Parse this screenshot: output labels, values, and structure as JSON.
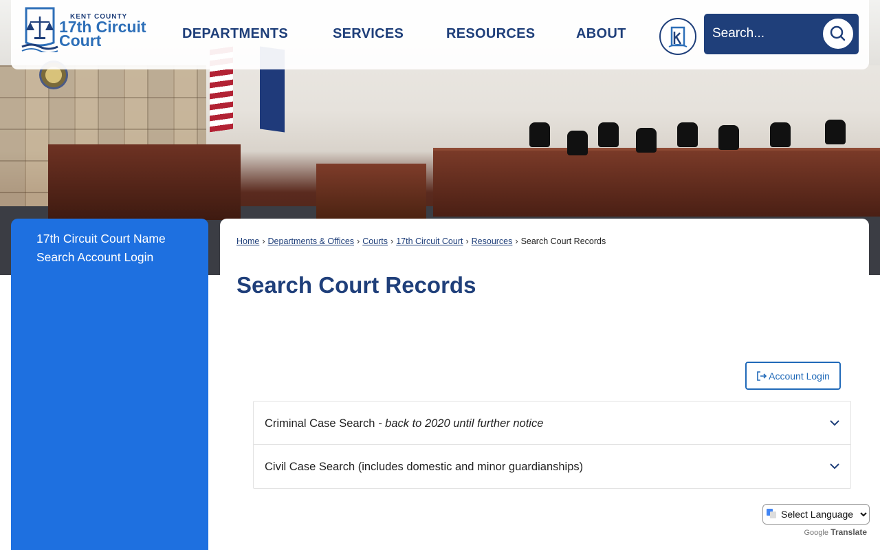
{
  "brand": {
    "county": "KENT COUNTY",
    "name_line1": "17th Circuit",
    "name_line2": "Court",
    "accent": "#1f3f7a",
    "logo_blue": "#2d6fb8"
  },
  "nav": {
    "departments": "DEPARTMENTS",
    "services": "SERVICES",
    "resources": "RESOURCES",
    "about": "ABOUT"
  },
  "search": {
    "placeholder": "Search...",
    "icon": "search-icon"
  },
  "sidebar": {
    "color": "#1e70e0",
    "items": [
      {
        "label": "17th Circuit Court Name"
      },
      {
        "label": "Search Account Login"
      }
    ]
  },
  "breadcrumb": {
    "items": [
      {
        "label": "Home"
      },
      {
        "label": "Departments & Offices"
      },
      {
        "label": "Courts"
      },
      {
        "label": "17th Circuit Court"
      },
      {
        "label": "Resources"
      }
    ],
    "current": "Search Court Records"
  },
  "page": {
    "title": "Search Court Records",
    "login_button": "Account Login"
  },
  "accordion": {
    "items": [
      {
        "label": "Criminal Case Search",
        "note": "- back to 2020 until further notice"
      },
      {
        "label": "Civil Case Search (includes domestic and minor guardianships)"
      }
    ]
  },
  "translate": {
    "select_label": "Select Language",
    "powered_google": "Google",
    "powered_translate": "Translate"
  }
}
